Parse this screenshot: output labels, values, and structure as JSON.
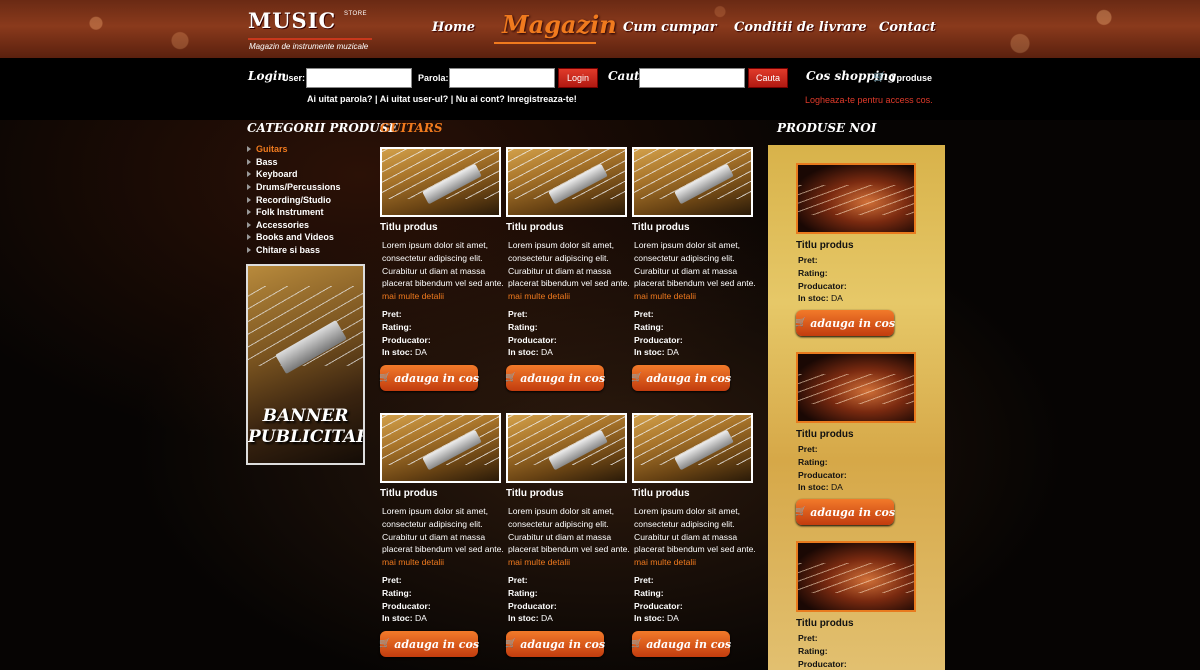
{
  "logo": {
    "word": "MUSIC",
    "sub": "STORE",
    "tagline": "Magazin de instrumente muzicale"
  },
  "nav": [
    {
      "label": "Home",
      "active": false
    },
    {
      "label": "Magazin",
      "active": true
    },
    {
      "label": "Cum cumpar",
      "active": false
    },
    {
      "label": "Conditii de livrare",
      "active": false
    },
    {
      "label": "Contact",
      "active": false
    }
  ],
  "login": {
    "title": "Login",
    "user_label": "User:",
    "user_value": "",
    "pass_label": "Parola:",
    "pass_value": "",
    "button": "Login",
    "links": "Ai uitat parola? | Ai uitat user-ul? | Nu ai cont? Inregistreaza-te!"
  },
  "search": {
    "title": "Cauta",
    "value": "",
    "button": "Cauta"
  },
  "cart": {
    "title": "Cos shopping",
    "count": "0 produse",
    "login_required": "Logheaza-te pentru access cos."
  },
  "categories": {
    "title": "CATEGORII PRODUSE",
    "items": [
      {
        "label": "Guitars",
        "active": true
      },
      {
        "label": "Bass",
        "active": false
      },
      {
        "label": "Keyboard",
        "active": false
      },
      {
        "label": "Drums/Percussions",
        "active": false
      },
      {
        "label": "Recording/Studio",
        "active": false
      },
      {
        "label": "Folk Instrument",
        "active": false
      },
      {
        "label": "Accessories",
        "active": false
      },
      {
        "label": "Books and Videos",
        "active": false
      },
      {
        "label": "Chitare si bass",
        "active": false
      }
    ]
  },
  "banner": {
    "line1": "BANNER",
    "line2": "PUBLICITAR"
  },
  "section": {
    "title": "GUITARS"
  },
  "product_template": {
    "title": "Titlu produs",
    "desc": "Lorem ipsum dolor sit amet, consectetur adipiscing elit. Curabitur ut diam at massa placerat bibendum vel sed ante.",
    "more": "mai multe detalii",
    "pret": "Pret:",
    "rating": "Rating:",
    "producator": "Producator:",
    "stoc_label": "In stoc:",
    "stoc_value": "DA",
    "cart_button": "adauga in cos"
  },
  "products_count": 6,
  "new_products": {
    "title": "PRODUSE NOI",
    "items": [
      {
        "title": "Titlu produs",
        "pret": "Pret:",
        "rating": "Rating:",
        "producator": "Producator:",
        "stoc_label": "In stoc:",
        "stoc_value": "DA",
        "cart_button": "adauga in cos"
      },
      {
        "title": "Titlu produs",
        "pret": "Pret:",
        "rating": "Rating:",
        "producator": "Producator:",
        "stoc_label": "In stoc:",
        "stoc_value": "DA",
        "cart_button": "adauga in cos"
      },
      {
        "title": "Titlu produs",
        "pret": "Pret:",
        "rating": "Rating:",
        "producator": "Producator:"
      }
    ]
  },
  "colors": {
    "accent_orange": "#f07a1e",
    "button_red": "#c8281a",
    "panel_gold": "#e0bc5c",
    "header_brown": "#7a3218"
  }
}
